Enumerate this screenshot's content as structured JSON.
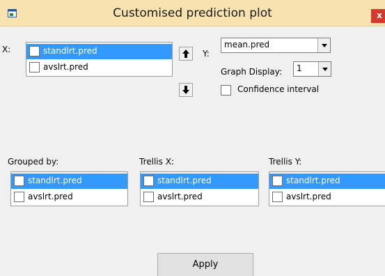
{
  "window": {
    "title": "Customised prediction plot",
    "close_label": "x"
  },
  "x_panel": {
    "label": "X:",
    "items": [
      {
        "label": "standlrt.pred",
        "selected": true,
        "checked": false
      },
      {
        "label": "avslrt.pred",
        "selected": false,
        "checked": false
      }
    ]
  },
  "y_panel": {
    "label": "Y:",
    "value": "mean.pred"
  },
  "graph_display": {
    "label": "Graph Display:",
    "value": "1"
  },
  "confidence_interval": {
    "label": "Confidence interval",
    "checked": false
  },
  "grouped_by": {
    "label": "Grouped by:",
    "items": [
      {
        "label": "standlrt.pred",
        "selected": true
      },
      {
        "label": "avslrt.pred",
        "selected": false
      }
    ]
  },
  "trellis_x": {
    "label": "Trellis X:",
    "items": [
      {
        "label": "standlrt.pred",
        "selected": true
      },
      {
        "label": "avslrt.pred",
        "selected": false
      }
    ]
  },
  "trellis_y": {
    "label": "Trellis Y:",
    "items": [
      {
        "label": "standlrt.pred",
        "selected": true
      },
      {
        "label": "avslrt.pred",
        "selected": false
      }
    ]
  },
  "buttons": {
    "apply_label": "Apply"
  },
  "icons": {
    "app": "app-window-icon",
    "move_up": "arrow-up-icon",
    "move_down": "arrow-down-icon",
    "dropdown": "chevron-down-icon"
  },
  "colors": {
    "titlebar": "#f8e3b0",
    "selection": "#3399ff",
    "close": "#d33a2c"
  }
}
